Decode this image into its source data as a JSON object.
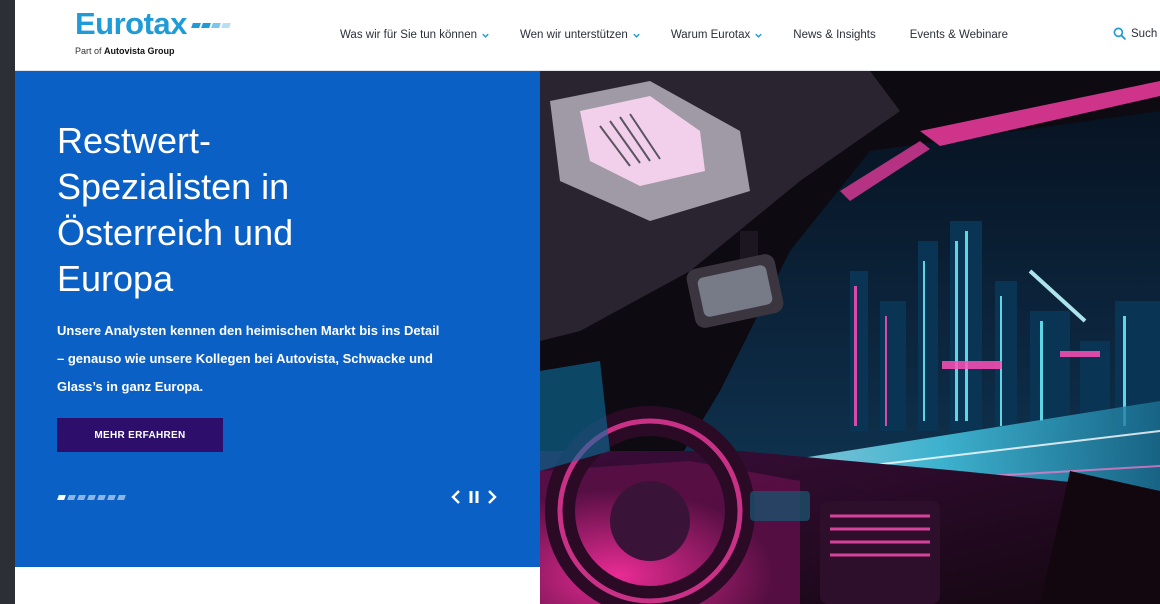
{
  "header": {
    "logo_word": "Eurotax",
    "logo_sub_prefix": "Part of ",
    "logo_sub_brand": "Autovista Group",
    "nav": [
      {
        "label": "Was wir für Sie tun können",
        "dropdown": true
      },
      {
        "label": "Wen wir unterstützen",
        "dropdown": true
      },
      {
        "label": "Warum Eurotax",
        "dropdown": true
      },
      {
        "label": "News & Insights",
        "dropdown": false
      },
      {
        "label": "Events & Webinare",
        "dropdown": false
      }
    ],
    "search_label": "Such"
  },
  "hero": {
    "title_lines": [
      "Restwert-",
      "Spezialisten in",
      "Österreich und",
      "Europa"
    ],
    "text_lines": [
      "Unsere Analysten kennen den heimischen Markt bis ins Detail",
      "– genauso wie unsere Kollegen bei Autovista, Schwacke und",
      "Glass’s in ganz Europa."
    ],
    "cta_label": "MEHR ERFAHREN",
    "slides_total": 7,
    "active_slide": 1
  },
  "colors": {
    "brand": "#1f9bd7",
    "hero_blue": "#0b60c5",
    "cta_bg": "#2d0e6b",
    "nav_text": "#2a2f3a"
  }
}
